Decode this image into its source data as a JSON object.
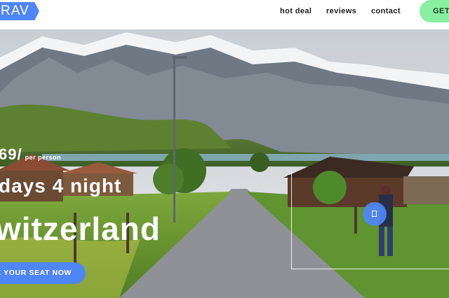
{
  "header": {
    "logo_text": "RAV",
    "nav": [
      {
        "label": "hot deal"
      },
      {
        "label": "reviews"
      },
      {
        "label": "contact"
      }
    ],
    "cta_label": "GET"
  },
  "hero": {
    "price": "69/",
    "per_person": "per person",
    "duration": "days 4 night",
    "destination": "witzerland",
    "book_button": "OK YOUR SEAT NOW"
  },
  "colors": {
    "accent": "#4f86f7",
    "header_cta": "#88f0a0",
    "hero_text": "#ffffff"
  },
  "icons": {
    "play": "play-icon"
  }
}
